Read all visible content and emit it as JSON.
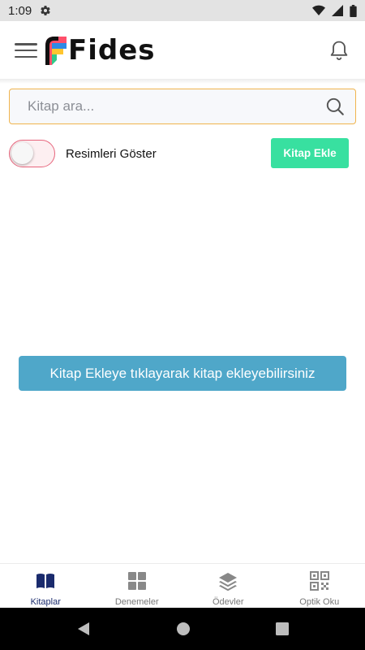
{
  "status_bar": {
    "time": "1:09",
    "icons": [
      "gear-icon",
      "wifi-icon",
      "cellular-icon",
      "battery-icon"
    ]
  },
  "app_bar": {
    "logo_text": "Fides",
    "icons": [
      "menu-icon",
      "bell-icon"
    ]
  },
  "search": {
    "placeholder": "Kitap ara...",
    "value": ""
  },
  "controls": {
    "toggle_label": "Resimleri Göster",
    "toggle_on": false,
    "add_button_label": "Kitap Ekle"
  },
  "info_banner": {
    "text": "Kitap Ekleye tıklayarak kitap ekleyebilirsiniz"
  },
  "bottom_nav": {
    "items": [
      {
        "label": "Kitaplar",
        "icon": "book-open-icon",
        "active": true
      },
      {
        "label": "Denemeler",
        "icon": "grid-icon",
        "active": false
      },
      {
        "label": "Ödevler",
        "icon": "layers-icon",
        "active": false
      },
      {
        "label": "Optik Oku",
        "icon": "qr-code-icon",
        "active": false
      }
    ]
  },
  "system_nav": {
    "icons": [
      "back-icon",
      "home-icon",
      "recents-icon"
    ]
  },
  "colors": {
    "accent_green": "#38e0a0",
    "banner_blue": "#4fa7c9",
    "search_border": "#f0b44d",
    "toggle_border": "#e7657c",
    "active_nav": "#1a2b6d"
  }
}
